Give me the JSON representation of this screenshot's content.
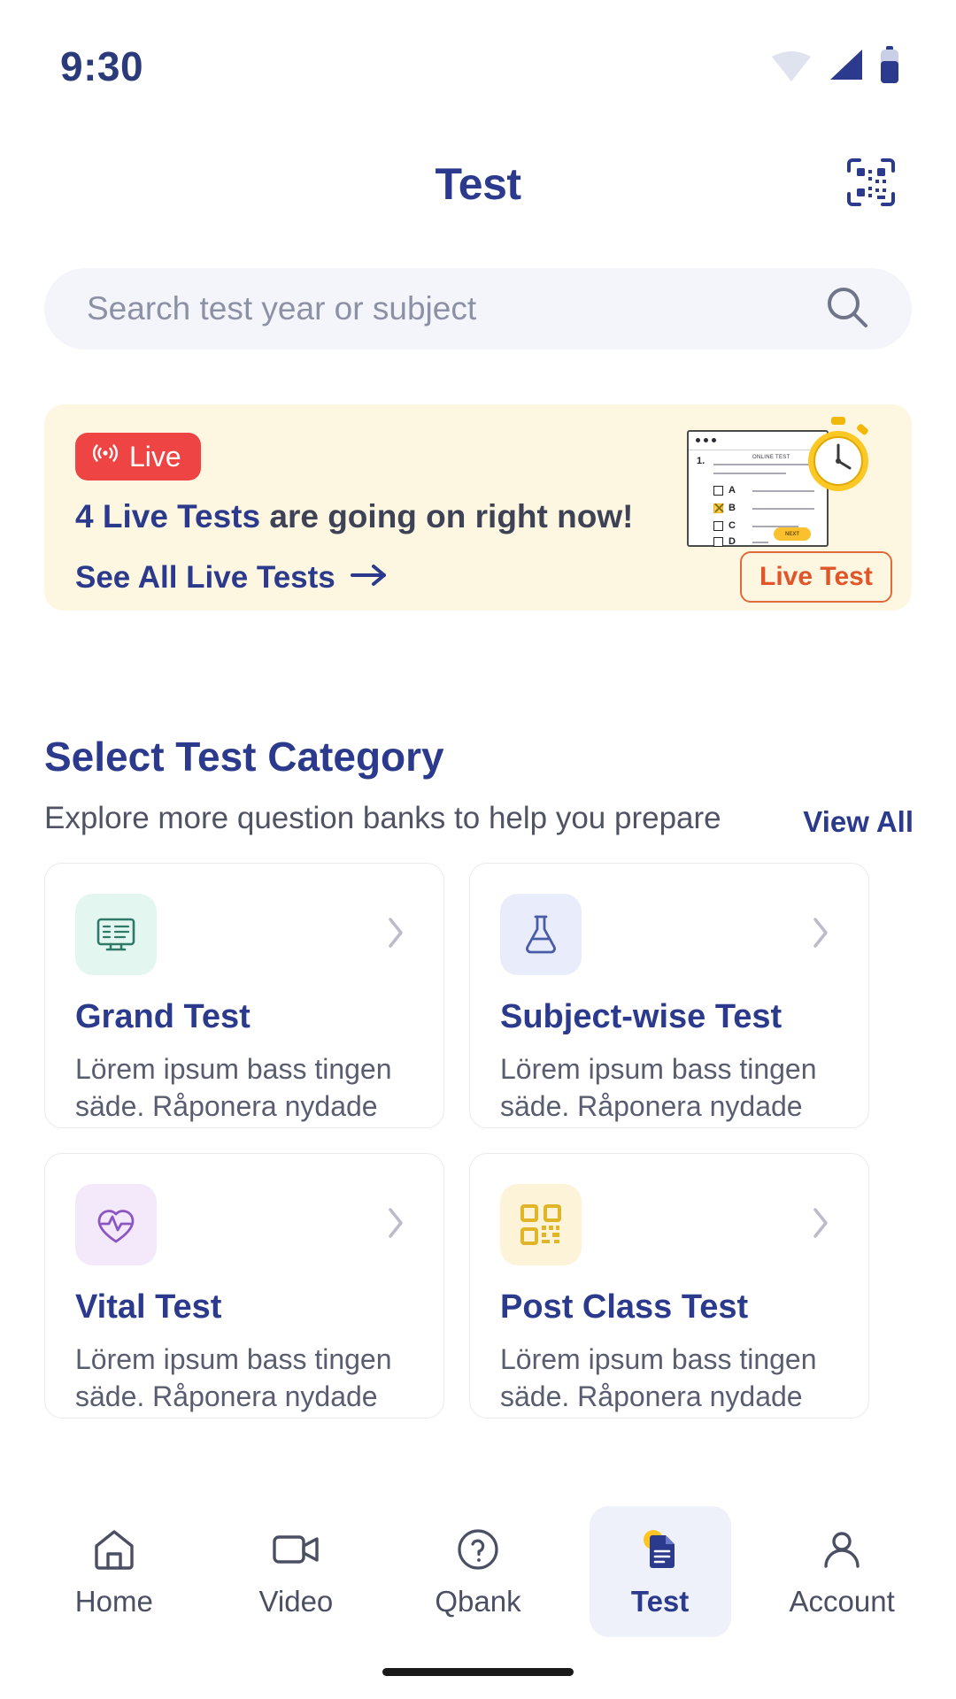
{
  "status_bar": {
    "time": "9:30",
    "icons": [
      "wifi-icon",
      "cellular-signal-icon",
      "battery-icon"
    ]
  },
  "header": {
    "title": "Test",
    "qr_icon": "qr-scan-icon"
  },
  "search": {
    "placeholder": "Search test year or subject",
    "value": "",
    "icon": "search-icon"
  },
  "live_banner": {
    "badge_label": "Live",
    "badge_icon": "broadcast-icon",
    "badge_color": "#ef4444",
    "background_color": "#fdf6e0",
    "headline_highlight": "4 Live Tests",
    "headline_rest": " are going on right now!",
    "link_label": "See All Live Tests",
    "link_icon": "arrow-right-icon",
    "illustration": {
      "card_question_number": "1.",
      "card_header": "ONLINE TEST",
      "options": [
        "A",
        "B",
        "C",
        "D"
      ],
      "checked_option": "B",
      "next_button_label": "NEXT",
      "watch_icon": "stopwatch-icon",
      "pill_label": "Live Test",
      "pill_color": "#e0562a"
    }
  },
  "category_section": {
    "title": "Select Test Category",
    "subtitle": "Explore more question banks to help you prepare",
    "view_all_label": "View All",
    "cards": [
      {
        "name": "Grand Test",
        "desc": "Lörem ipsum bass tingen säde. Råponera nydade",
        "icon": "monitor-test-icon",
        "icon_bg": "#e3f7f0",
        "chevron": "chevron-right-icon"
      },
      {
        "name": "Subject-wise Test",
        "desc": "Lörem ipsum bass tingen säde. Råponera nydade",
        "icon": "flask-icon",
        "icon_bg": "#e9edfb",
        "chevron": "chevron-right-icon"
      },
      {
        "name": "Vital Test",
        "desc": "Lörem ipsum bass tingen säde. Råponera nydade",
        "icon": "heart-pulse-icon",
        "icon_bg": "#f3e9fb",
        "chevron": "chevron-right-icon"
      },
      {
        "name": "Post Class Test",
        "desc": "Lörem ipsum bass tingen säde. Råponera nydade",
        "icon": "qr-code-icon",
        "icon_bg": "#fdf3d8",
        "chevron": "chevron-right-icon"
      }
    ]
  },
  "bottom_nav": {
    "active": "Test",
    "items": [
      {
        "label": "Home",
        "icon": "home-icon"
      },
      {
        "label": "Video",
        "icon": "video-camera-icon"
      },
      {
        "label": "Qbank",
        "icon": "question-circle-icon"
      },
      {
        "label": "Test",
        "icon": "document-icon"
      },
      {
        "label": "Account",
        "icon": "person-icon"
      }
    ]
  },
  "colors": {
    "primary_navy": "#2b3a8c",
    "banner_yellow": "#fdf6e0",
    "live_red": "#ef4444",
    "search_bg": "#f4f5fb"
  }
}
